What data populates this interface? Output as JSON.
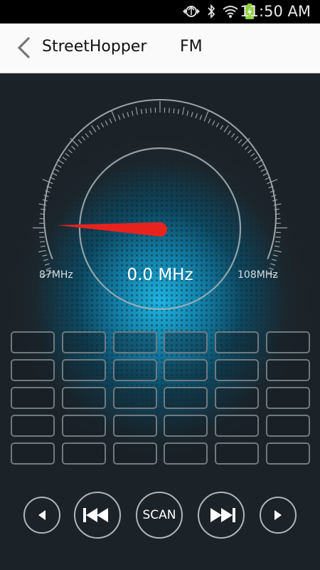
{
  "status_bar": {
    "time": "11:50 AM",
    "icons": [
      "data-sync-icon",
      "bluetooth-icon",
      "wifi-icon",
      "battery-charging-icon"
    ]
  },
  "header": {
    "back_icon": "chevron-left-icon",
    "app_title": "StreetHopper",
    "band": "FM"
  },
  "tuner": {
    "frequency": "0.0 MHz",
    "min_label": "87MHz",
    "max_label": "108MHz",
    "needle_color": "#e8231e",
    "accent_color": "#1eb3e0"
  },
  "presets": {
    "rows": 5,
    "columns": 6
  },
  "controls": {
    "prev_icon": "triangle-left-icon",
    "seek_back_icon": "skip-back-icon",
    "scan_label": "SCAN",
    "seek_forward_icon": "skip-forward-icon",
    "next_icon": "triangle-right-icon"
  }
}
